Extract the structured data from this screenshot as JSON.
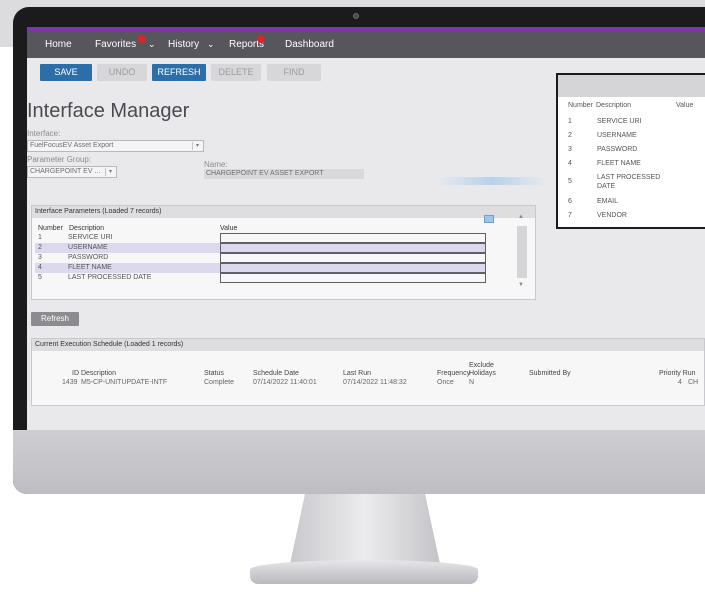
{
  "menu": {
    "home": "Home",
    "favorites": "Favorites",
    "favorites_badge": "4",
    "history": "History",
    "reports": "Reports",
    "reports_badge": "1",
    "dashboard": "Dashboard"
  },
  "toolbar": {
    "save": "SAVE",
    "undo": "UNDO",
    "refresh": "REFRESH",
    "delete": "DELETE",
    "find": "FIND"
  },
  "page": {
    "title": "Interface Manager",
    "interface_label": "Interface:",
    "interface_value": "FuelFocusEV Asset Export",
    "param_group_label": "Parameter Group:",
    "param_group_value": "CHARGEPOINT EV ...",
    "name_label": "Name:",
    "name_value": "CHARGEPOINT EV ASSET EXPORT"
  },
  "parameters": {
    "header": "Interface Parameters (Loaded 7 records)",
    "col_number": "Number",
    "col_description": "Description",
    "col_value": "Value",
    "rows": [
      {
        "number": "1",
        "description": "SERVICE URI"
      },
      {
        "number": "2",
        "description": "USERNAME"
      },
      {
        "number": "3",
        "description": "PASSWORD"
      },
      {
        "number": "4",
        "description": "FLEET NAME"
      },
      {
        "number": "5",
        "description": "LAST PROCESSED DATE"
      }
    ]
  },
  "refresh_button": "Refresh",
  "schedule": {
    "header": "Current Execution Schedule (Loaded 1 records)",
    "columns": {
      "id_desc": "ID Description",
      "status": "Status",
      "schedule_date": "Schedule Date",
      "last_run": "Last Run",
      "frequency": "Frequency",
      "exclude": "Exclude",
      "holidays": "Holidays",
      "submitted_by": "Submitted By",
      "priority": "Priority Run"
    },
    "row": {
      "id": "1439",
      "description": "M5-CP-UNITUPDATE-INTF",
      "status": "Complete",
      "schedule_date": "07/14/2022 11:40:01",
      "last_run": "07/14/2022 11:48:32",
      "frequency": "Once",
      "exclude_holidays": "N",
      "priority": "4",
      "run": "CH"
    }
  },
  "zoom_panel": {
    "col_number": "Number",
    "col_description": "Description",
    "col_value": "Value",
    "rows": [
      {
        "number": "1",
        "description": "SERVICE URI"
      },
      {
        "number": "2",
        "description": "USERNAME"
      },
      {
        "number": "3",
        "description": "PASSWORD"
      },
      {
        "number": "4",
        "description": "FLEET NAME"
      },
      {
        "number": "5",
        "description": "LAST PROCESSED DATE"
      },
      {
        "number": "6",
        "description": "EMAIL"
      },
      {
        "number": "7",
        "description": "VENDOR"
      }
    ]
  },
  "colors": {
    "accent_purple": "#7a3aa0",
    "menubar": "#57565c",
    "button_blue": "#2b6ea8",
    "badge_red": "#d9252c"
  }
}
